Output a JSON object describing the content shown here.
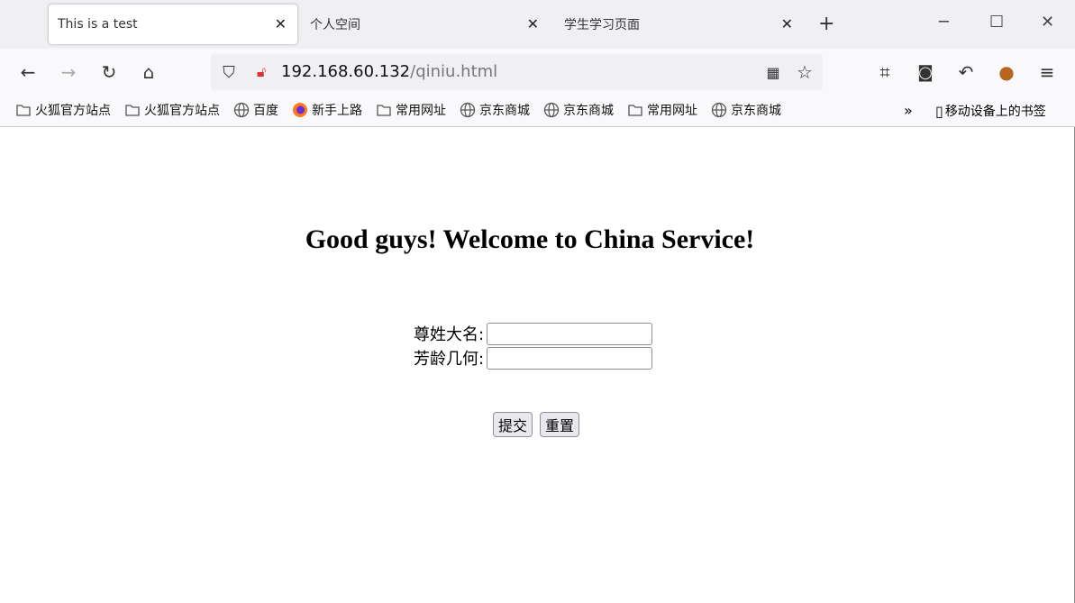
{
  "tabs": [
    {
      "title": "This is a test",
      "active": true
    },
    {
      "title": "个人空间"
    },
    {
      "title": "学生学习页面"
    }
  ],
  "url": {
    "host": "192.168.60.132",
    "path": "/qiniu.html"
  },
  "bookmarks": [
    {
      "label": "火狐官方站点",
      "icon": "folder-icon"
    },
    {
      "label": "火狐官方站点",
      "icon": "folder-icon"
    },
    {
      "label": "百度",
      "icon": "globe-icon"
    },
    {
      "label": "新手上路",
      "icon": "firefox-icon"
    },
    {
      "label": "常用网址",
      "icon": "folder-icon"
    },
    {
      "label": "京东商城",
      "icon": "globe-icon"
    },
    {
      "label": "京东商城",
      "icon": "globe-icon"
    },
    {
      "label": "常用网址",
      "icon": "folder-icon"
    },
    {
      "label": "京东商城",
      "icon": "globe-icon"
    }
  ],
  "mobile_bookmarks": "移动设备上的书签",
  "page": {
    "heading": "Good guys! Welcome to China Service!",
    "name_label": "尊姓大名:",
    "age_label": "芳龄几何:",
    "name_value": "",
    "age_value": "",
    "submit": "提交",
    "reset": "重置"
  }
}
